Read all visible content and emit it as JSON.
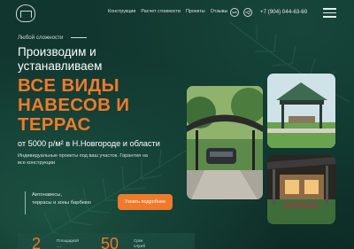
{
  "nav": {
    "items": [
      {
        "label": "Конструкции"
      },
      {
        "label": "Расчет стоимости"
      },
      {
        "label": "Проекты"
      },
      {
        "label": "Отзывы"
      }
    ]
  },
  "social": {
    "first_icon": "vk-icon",
    "second_icon": "telegram-icon",
    "first_label": "vk",
    "second_label": "tg"
  },
  "header": {
    "phone": "+7 (904) 044-63-60"
  },
  "hero": {
    "eyebrow": "Любой сложности",
    "title_line1": "Производим и",
    "title_line2": "устанавливаем",
    "accent_line1": "все виды",
    "accent_line2": "навесов и",
    "accent_line3": "террас",
    "price": "от 5000 р/м² в Н.Новгороде и области",
    "desc_line1": "Индивидуальные проекты под ваш участок. Гарантия на",
    "desc_line2": "все конструкции",
    "feature_line1": "Автонавесы,",
    "feature_line2": "террасы и зоны барбекю",
    "cta": "Узнать подробнее"
  },
  "stats": [
    {
      "value": "2",
      "label_line1": "Площадкой",
      "label_line2": "...."
    },
    {
      "value": "50",
      "label_line1": "Срок",
      "label_line2": "служб"
    }
  ],
  "colors": {
    "accent": "#f07a2a",
    "background": "#113a32"
  }
}
